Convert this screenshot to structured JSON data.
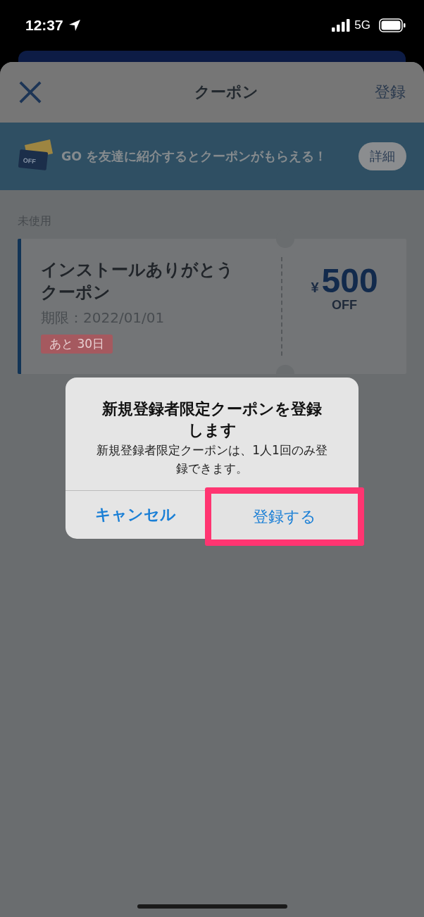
{
  "status_bar": {
    "time": "12:37",
    "network": "5G"
  },
  "header": {
    "title": "クーポン",
    "action": "登録"
  },
  "banner": {
    "ticket_label": "OFF",
    "text": "GO を友達に紹介するとクーポンがもらえる！",
    "button": "詳細"
  },
  "section_label": "未使用",
  "coupons": [
    {
      "title": "インストールありがとうクーポン",
      "expiry": "期限：2022/01/01",
      "remaining": "あと 30日",
      "currency": "¥",
      "amount": "500",
      "unit": "OFF"
    }
  ],
  "dialog": {
    "title": "新規登録者限定クーポンを登録します",
    "message": "新規登録者限定クーポンは、1人1回のみ登録できます。",
    "actions": [
      {
        "label": "キャンセル",
        "kind": "cancel",
        "highlighted": false
      },
      {
        "label": "登録する",
        "kind": "default",
        "highlighted": true
      }
    ]
  }
}
